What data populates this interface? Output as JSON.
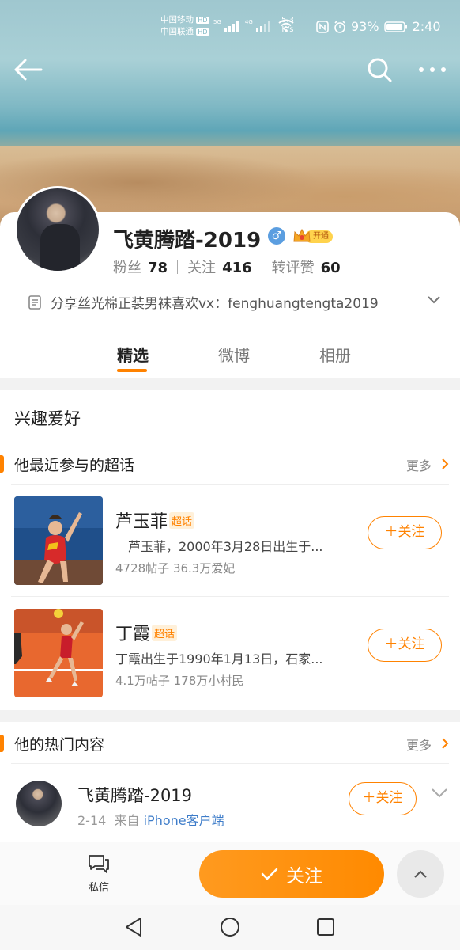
{
  "status_bar": {
    "carrier1": "中国移动",
    "carrier2": "中国联通",
    "hd": "HD",
    "net1": "5G",
    "net2": "4G",
    "speed_value": "5.3",
    "speed_unit": "K/s",
    "battery": "93%",
    "time": "2:40"
  },
  "profile": {
    "name": "飞黄腾踏-2019",
    "gender_symbol": "♂",
    "vip_tag": "开通",
    "fans_label": "粉丝",
    "fans_count": "78",
    "following_label": "关注",
    "following_count": "416",
    "interactions_label": "转评赞",
    "interactions_count": "60",
    "bio": "分享丝光棉正装男袜喜欢vx：fenghuangtengta2019"
  },
  "tabs": [
    {
      "label": "精选",
      "active": true
    },
    {
      "label": "微博",
      "active": false
    },
    {
      "label": "相册",
      "active": false
    }
  ],
  "interests": {
    "title": "兴趣爱好",
    "super_topics_header": "他最近参与的超话",
    "more_label": "更多",
    "topics": [
      {
        "name": "芦玉菲",
        "tag": "超话",
        "desc": "　芦玉菲，2000年3月28日出生于...",
        "stats": "4728帖子 36.3万爱妃",
        "follow_label": "＋关注"
      },
      {
        "name": "丁霞",
        "tag": "超话",
        "desc": "丁霞出生于1990年1月13日，石家...",
        "stats": "4.1万帖子 178万小村民",
        "follow_label": "＋关注"
      }
    ]
  },
  "hot": {
    "header": "他的热门内容",
    "more_label": "更多",
    "post": {
      "author": "飞黄腾踏-2019",
      "date": "2-14",
      "from_label": "来自",
      "source": "iPhone客户端",
      "follow_label": "＋关注"
    }
  },
  "bottom_bar": {
    "dm_label": "私信",
    "follow_label": "关注"
  },
  "colors": {
    "accent": "#ff8200",
    "link": "#3d7cc9"
  }
}
